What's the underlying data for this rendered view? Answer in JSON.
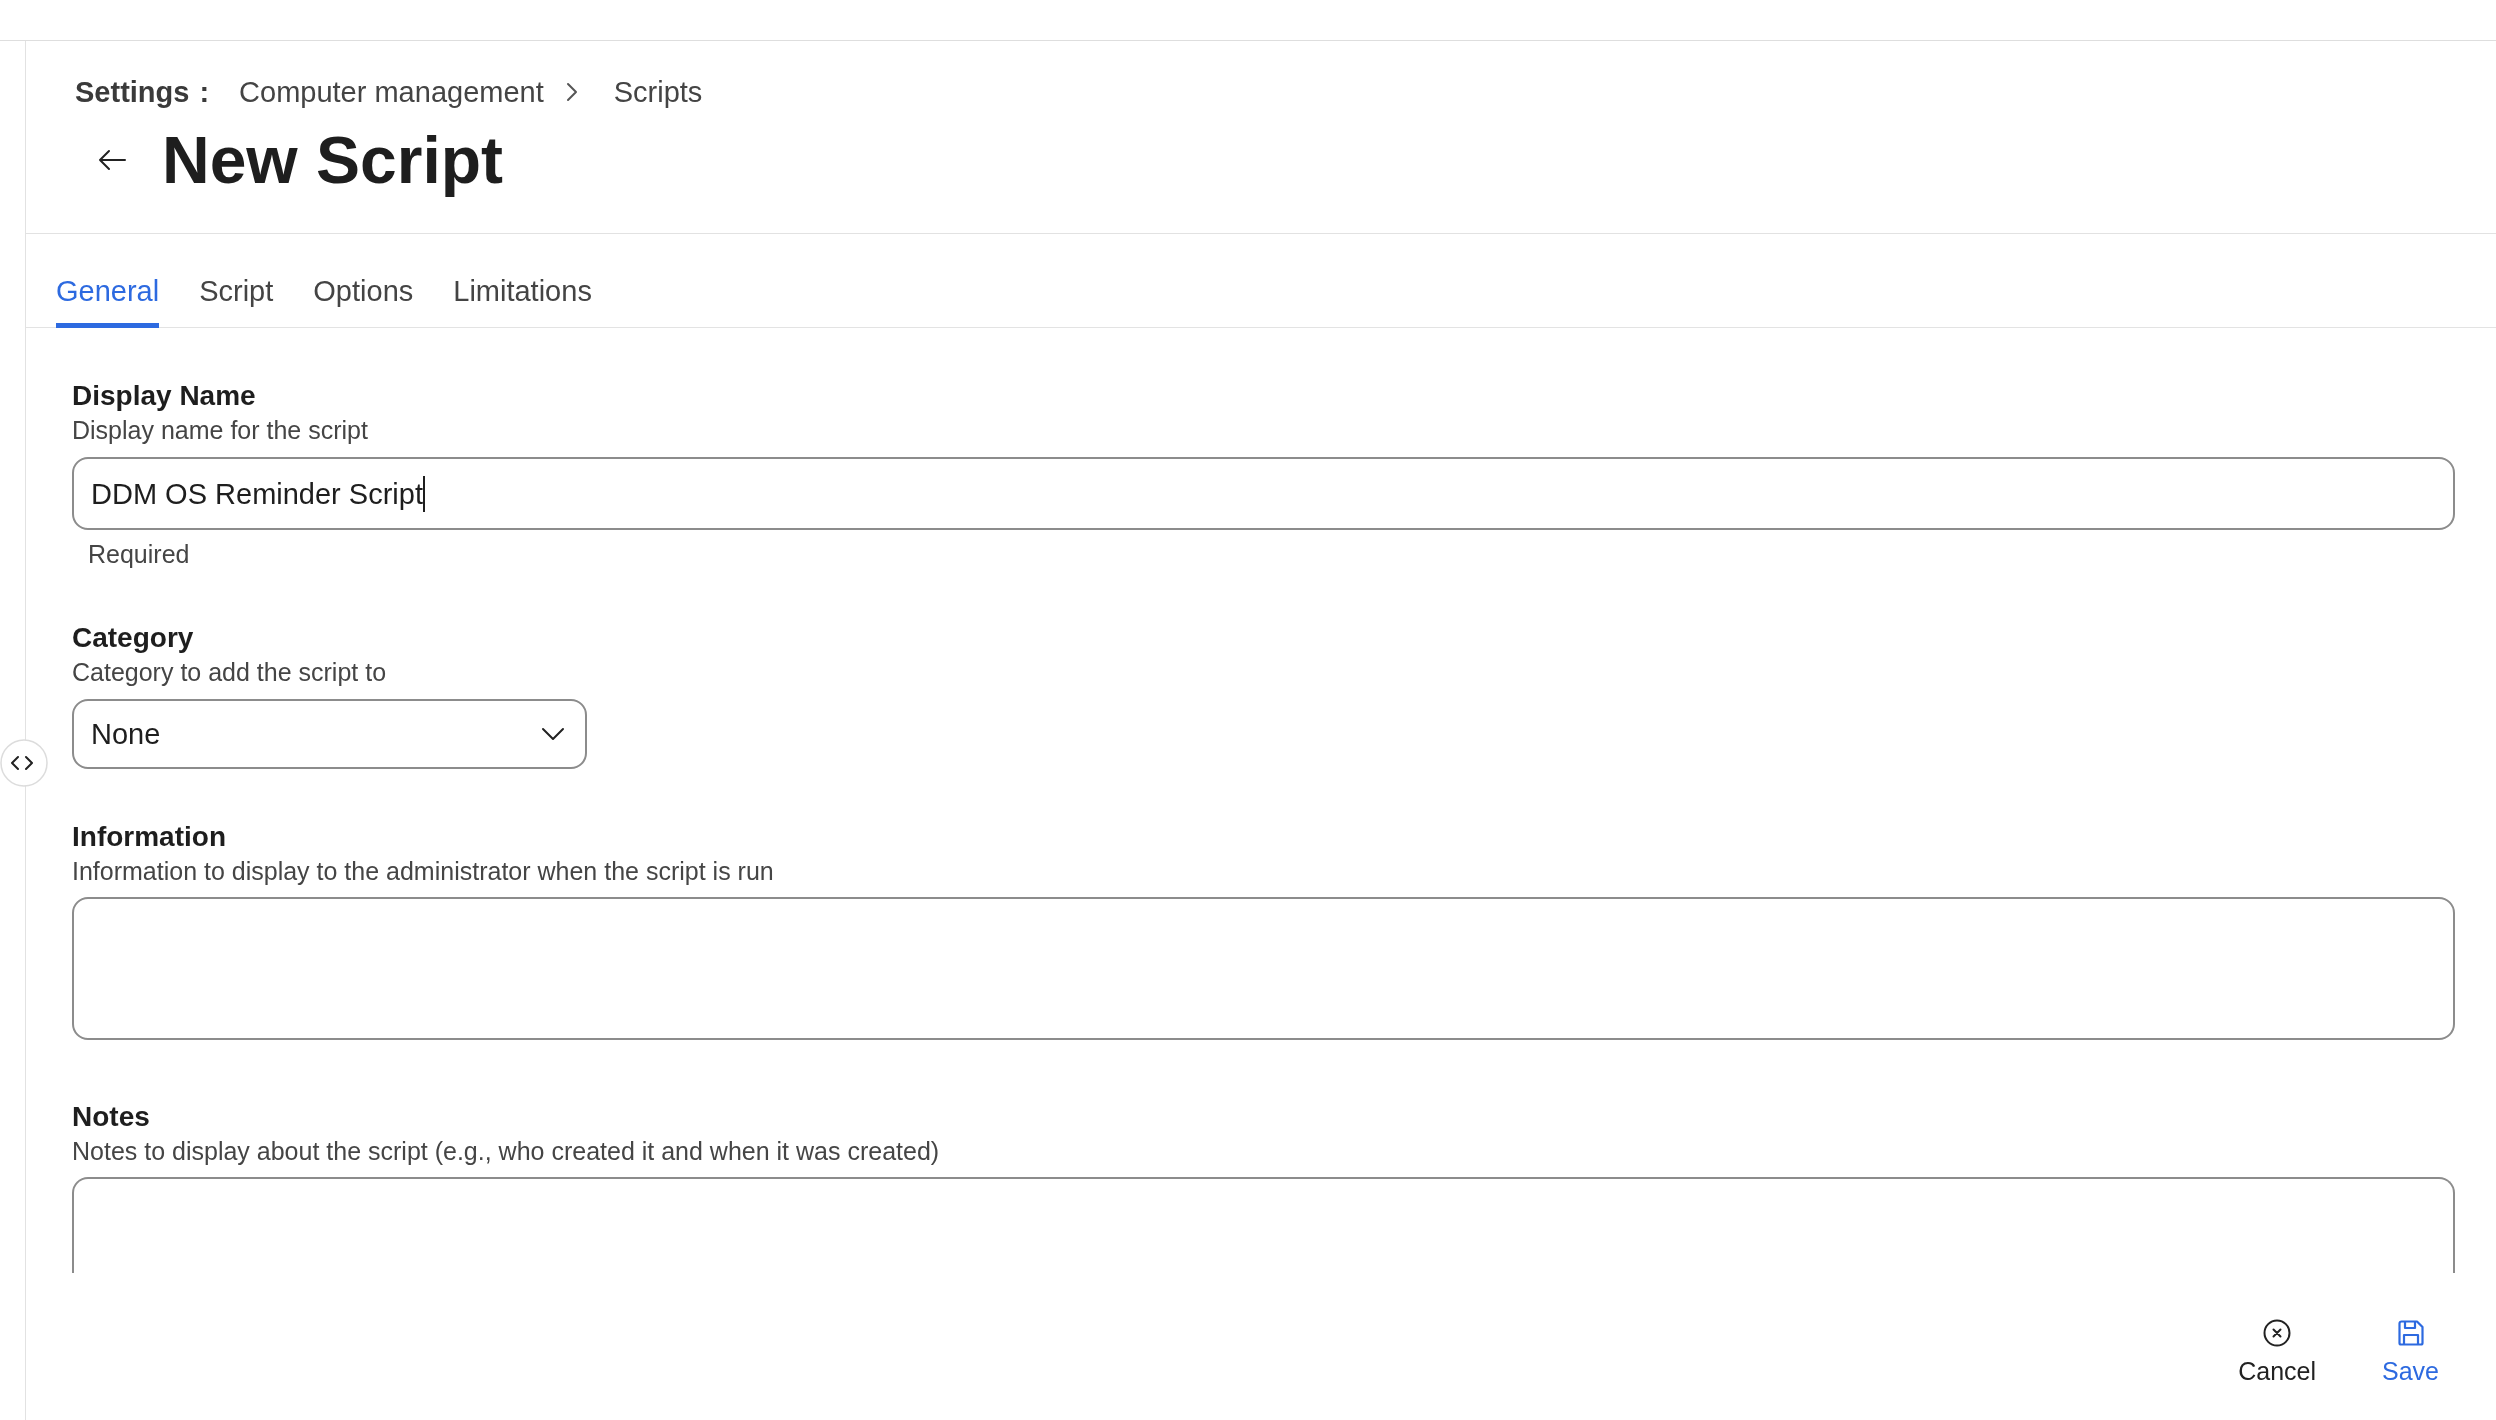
{
  "breadcrumb": {
    "root": "Settings",
    "root_separator": ":",
    "items": [
      "Computer management",
      "Scripts"
    ]
  },
  "page": {
    "title": "New Script"
  },
  "tabs": [
    {
      "label": "General",
      "selected": true
    },
    {
      "label": "Script",
      "selected": false
    },
    {
      "label": "Options",
      "selected": false
    },
    {
      "label": "Limitations",
      "selected": false
    }
  ],
  "fields": [
    {
      "kind": "text",
      "label": "Display Name",
      "description": "Display name for the script",
      "value": "DDM OS Reminder Script",
      "focused": true,
      "helper": "Required"
    },
    {
      "kind": "select",
      "label": "Category",
      "description": "Category to add the script to",
      "value": "None"
    },
    {
      "kind": "textarea",
      "label": "Information",
      "description": "Information to display to the administrator when the script is run"
    },
    {
      "kind": "textarea",
      "label": "Notes",
      "description": "Notes to display about the script (e.g., who created it and when it was created)"
    }
  ],
  "footer": {
    "buttons": [
      {
        "kind": "cancel",
        "label": "Cancel"
      },
      {
        "kind": "save",
        "label": "Save"
      }
    ]
  }
}
